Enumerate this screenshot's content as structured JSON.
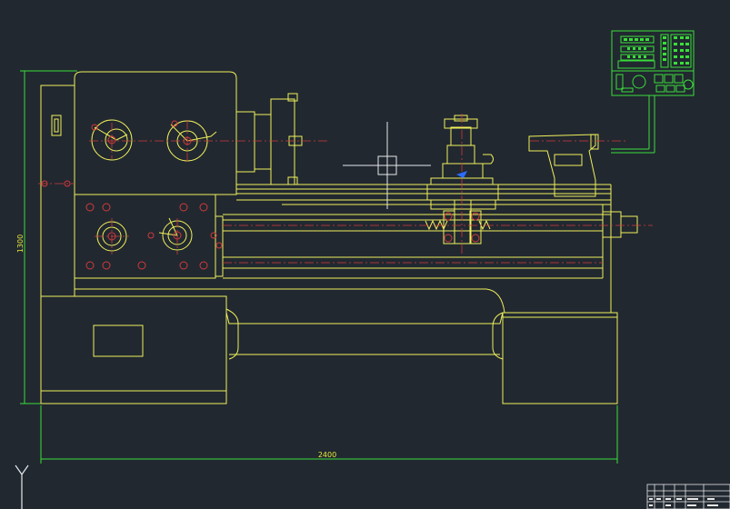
{
  "drawing": {
    "dimension_width": "2400",
    "dimension_height": "1300",
    "ucs_axis_label": "Y"
  },
  "colors": {
    "background": "#212830",
    "outline": "#f0f05a",
    "centerline": "#d33a3a",
    "control_panel": "#3ade3a",
    "crosshair": "#e8e8e8",
    "highlight": "#2a6cff"
  }
}
